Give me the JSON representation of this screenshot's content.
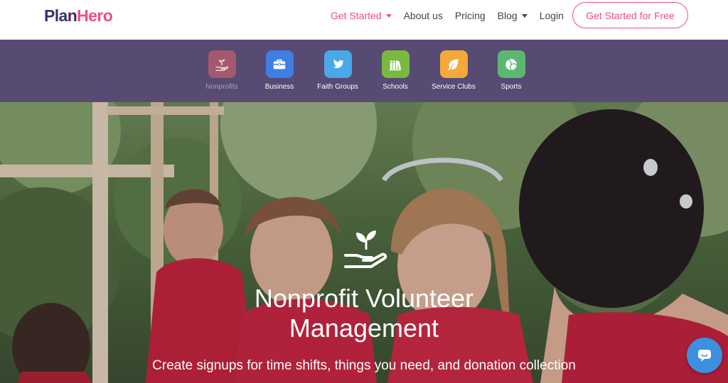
{
  "brand": {
    "name_part1": "Plan",
    "name_part2": "Hero"
  },
  "nav": {
    "items": [
      {
        "label": "Get Started",
        "dropdown": true,
        "active": true
      },
      {
        "label": "About us",
        "dropdown": false,
        "active": false
      },
      {
        "label": "Pricing",
        "dropdown": false,
        "active": false
      },
      {
        "label": "Blog",
        "dropdown": true,
        "active": false
      },
      {
        "label": "Login",
        "dropdown": false,
        "active": false
      }
    ],
    "cta_label": "Get Started for Free"
  },
  "categories": [
    {
      "label": "Nonprofits",
      "icon": "hand-sprout-icon",
      "color": "#a35a6e",
      "active": true
    },
    {
      "label": "Business",
      "icon": "briefcase-icon",
      "color": "#3d7fe3",
      "active": false
    },
    {
      "label": "Faith Groups",
      "icon": "bird-icon",
      "color": "#4aa8e8",
      "active": false
    },
    {
      "label": "Schools",
      "icon": "books-icon",
      "color": "#7ab93f",
      "active": false
    },
    {
      "label": "Service Clubs",
      "icon": "leaf-icon",
      "color": "#f5a93b",
      "active": false
    },
    {
      "label": "Sports",
      "icon": "volleyball-icon",
      "color": "#5cb870",
      "active": false
    }
  ],
  "hero": {
    "icon": "hand-sprout-icon",
    "title_line1": "Nonprofit Volunteer",
    "title_line2": "Management",
    "subtitle": "Create signups for time shifts, things you need, and donation collection"
  },
  "chat": {
    "icon": "chat-icon"
  },
  "colors": {
    "brand_dark": "#3f2f63",
    "brand_pink": "#ef4f7d",
    "category_bar": "#574a73"
  }
}
